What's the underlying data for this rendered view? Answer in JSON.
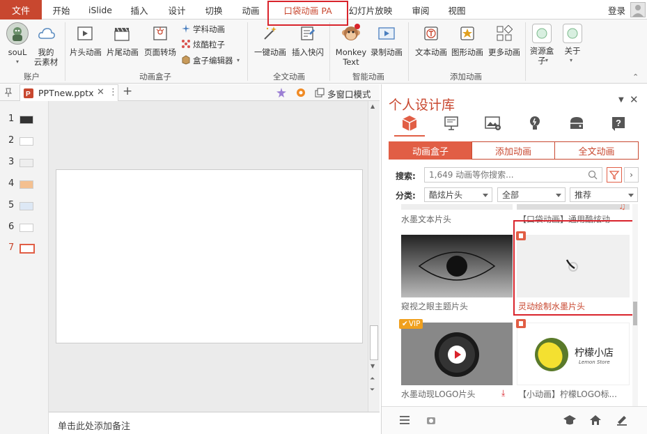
{
  "tabs": {
    "file": "文件",
    "start": "开始",
    "islide": "iSlide",
    "insert": "插入",
    "design": "设计",
    "transition": "切换",
    "animation": "动画",
    "pocket_anim": "口袋动画 PA",
    "slideshow": "幻灯片放映",
    "review": "审阅",
    "view": "视图",
    "login": "登录"
  },
  "ribbon": {
    "user_name": "souL",
    "cloud_line1": "我的",
    "cloud_line2": "云素材",
    "account_group": "账户",
    "head_anim": "片头动画",
    "tail_anim": "片尾动画",
    "page_transition": "页面转场",
    "subject_anim": "学科动画",
    "cool_particles": "炫酷粒子",
    "box_editor": "盒子编辑器",
    "anim_box_group": "动画盒子",
    "one_key_anim": "一键动画",
    "insert_frame": "插入快闪",
    "full_anim_group": "全文动画",
    "monkey_line1": "Monkey",
    "monkey_line2": "Text",
    "record_anim": "录制动画",
    "smart_anim_group": "智能动画",
    "text_anim": "文本动画",
    "shape_anim": "图形动画",
    "more_anim": "更多动画",
    "add_anim_group": "添加动画",
    "resource_line1": "资源盒",
    "resource_line2": "子",
    "about": "关于"
  },
  "doc": {
    "filename": "PPTnew.pptx",
    "multi_window": "多窗口模式",
    "notes_placeholder": "单击此处添加备注"
  },
  "slides": [
    "1",
    "2",
    "3",
    "4",
    "5",
    "6",
    "7"
  ],
  "panel": {
    "title": "个人设计库",
    "seg_box": "动画盒子",
    "seg_add": "添加动画",
    "seg_full": "全文动画",
    "search_label": "搜索:",
    "search_placeholder": "1,649 动画等你搜索...",
    "category_label": "分类:",
    "dd1": "酷炫片头",
    "dd2": "全部",
    "dd3": "推荐",
    "items": [
      {
        "caption": "水墨文本片头"
      },
      {
        "caption": "【口袋动画】通用酷炫动"
      },
      {
        "caption": "窥视之眼主题片头"
      },
      {
        "caption": "灵动绘制水墨片头"
      },
      {
        "caption": "水墨动现LOGO片头",
        "badge": "VIP"
      },
      {
        "caption": "【小动画】柠檬LOGO标..."
      }
    ],
    "lemon_title": "柠檬小店",
    "lemon_sub": "Lemon Store"
  },
  "colors": {
    "accent": "#c8472f",
    "highlight": "#d9232b"
  }
}
